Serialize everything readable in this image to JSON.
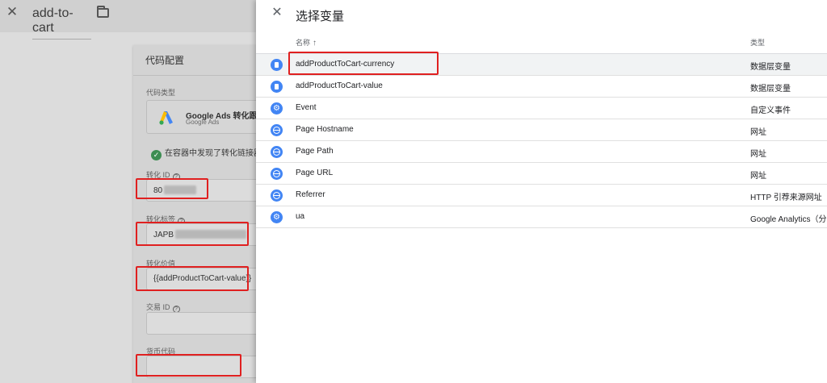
{
  "background": {
    "tag_title": "add-to-cart",
    "config_title": "代码配置",
    "tag_type_label": "代码类型",
    "tag_type_name": "Google Ads 转化跟踪",
    "tag_type_sub": "Google Ads",
    "detected_text": "在容器中发现了转化链接器",
    "fields": [
      {
        "label": "转化 ID",
        "value": "80"
      },
      {
        "label": "转化标签",
        "value": "JAPB"
      },
      {
        "label": "转化价值",
        "value": "{{addProductToCart-value}}"
      },
      {
        "label": "交易 ID",
        "value": ""
      },
      {
        "label": "货币代码",
        "value": ""
      }
    ]
  },
  "panel": {
    "title": "选择变量",
    "col_name": "名称",
    "col_type": "类型",
    "rows": [
      {
        "icon": "document-icon",
        "name": "addProductToCart-currency",
        "type": "数据层变量"
      },
      {
        "icon": "document-icon",
        "name": "addProductToCart-value",
        "type": "数据层变量"
      },
      {
        "icon": "gear-icon",
        "name": "Event",
        "type": "自定义事件"
      },
      {
        "icon": "globe-icon",
        "name": "Page Hostname",
        "type": "网址"
      },
      {
        "icon": "globe-icon",
        "name": "Page Path",
        "type": "网址"
      },
      {
        "icon": "globe-icon",
        "name": "Page URL",
        "type": "网址"
      },
      {
        "icon": "globe-icon",
        "name": "Referrer",
        "type": "HTTP 引荐来源网址"
      },
      {
        "icon": "gear-icon",
        "name": "ua",
        "type": "Google Analytics（分"
      }
    ]
  },
  "colors": {
    "accent": "#4285f4",
    "highlight": "#e02020"
  }
}
